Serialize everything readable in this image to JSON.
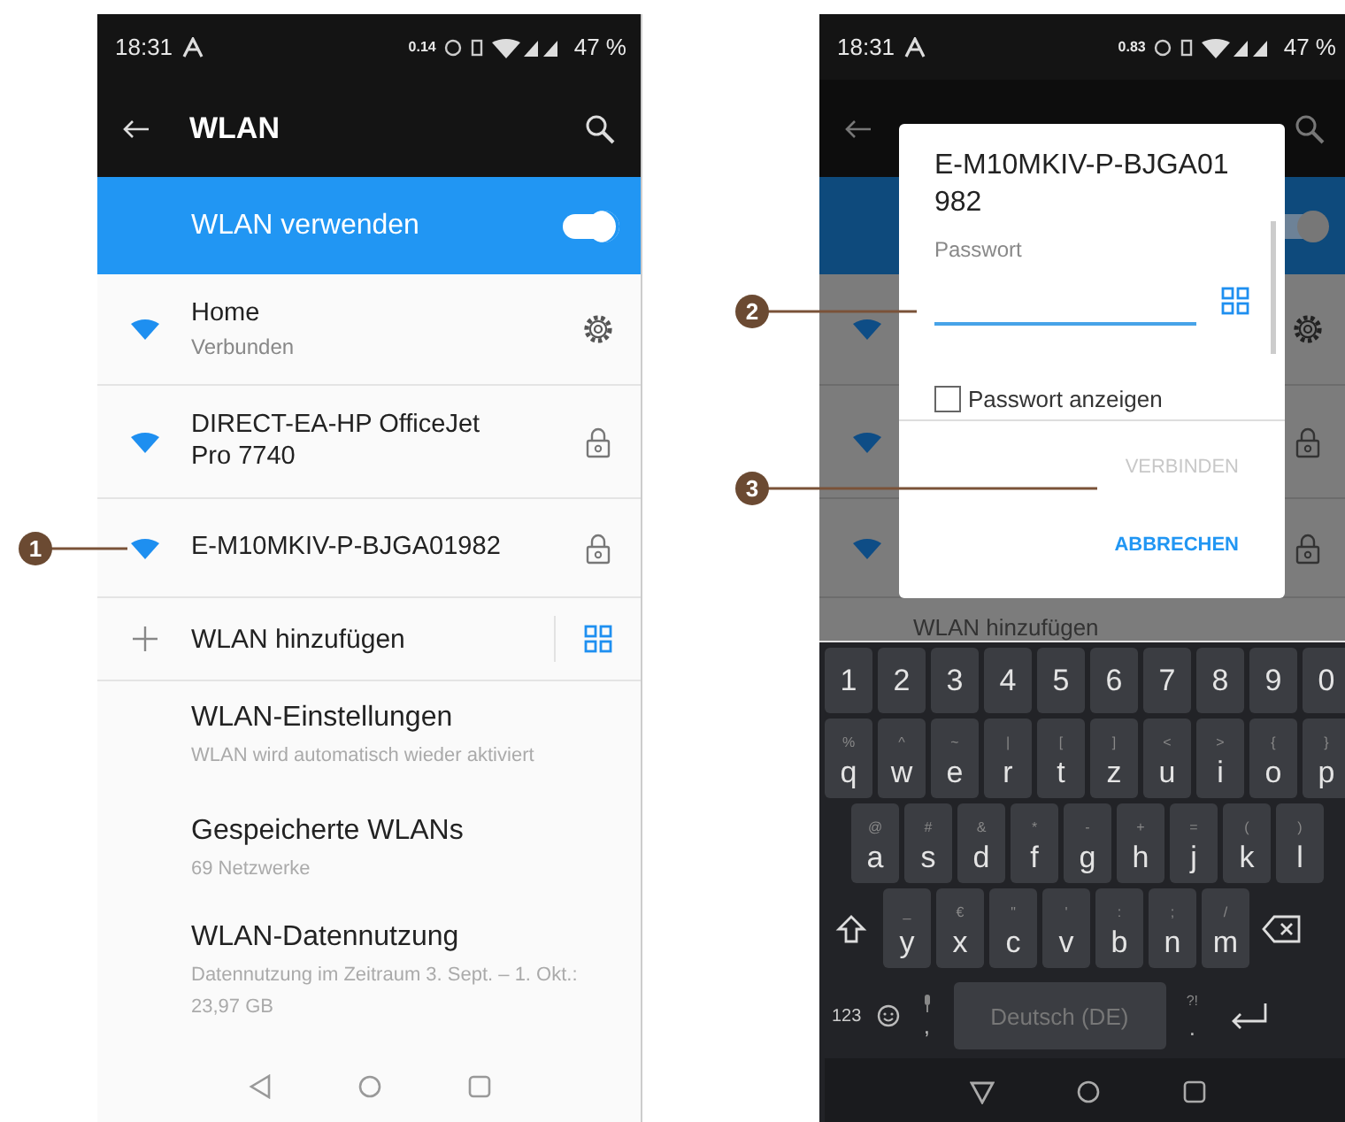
{
  "left_screen": {
    "status_bar": {
      "time": "18:31",
      "data_rate": "0.14",
      "battery": "47 %"
    },
    "toolbar": {
      "title": "WLAN"
    },
    "master_switch": {
      "label": "WLAN verwenden",
      "on": true
    },
    "networks": [
      {
        "name": "Home",
        "status": "Verbunden",
        "kind": "connected"
      },
      {
        "name": "DIRECT-EA-HP OfficeJet Pro 7740",
        "kind": "locked"
      },
      {
        "name": "E-M10MKIV-P-BJGA01982",
        "kind": "locked"
      }
    ],
    "add_network": {
      "label": "WLAN hinzufügen"
    },
    "settings_items": [
      {
        "title": "WLAN-Einstellungen",
        "subtitle": "WLAN wird automatisch wieder aktiviert"
      },
      {
        "title": "Gespeicherte WLANs",
        "subtitle": "69 Netzwerke"
      },
      {
        "title": "WLAN-Datennutzung",
        "subtitle": "Datennutzung im Zeitraum 3. Sept. – 1. Okt.: 23,97 GB"
      }
    ]
  },
  "right_screen": {
    "status_bar": {
      "time": "18:31",
      "data_rate": "0.83",
      "battery": "47 %"
    },
    "switch_on": true,
    "background_networks": [
      {
        "kind": "connected"
      },
      {
        "kind": "locked"
      },
      {
        "kind": "locked"
      }
    ],
    "add_network": {
      "label": "WLAN hinzufügen"
    },
    "dialog": {
      "title": "E-M10MKIV-P-BJGA01982",
      "field_label": "Passwort",
      "show_password": {
        "label": "Passwort anzeigen",
        "checked": false
      },
      "buttons": [
        {
          "label": "VERBINDEN",
          "disabled": true
        },
        {
          "label": "ABBRECHEN",
          "disabled": false
        }
      ]
    },
    "keyboard": {
      "rows": [
        {
          "keys": [
            {
              "key": "1"
            },
            {
              "key": "2"
            },
            {
              "key": "3"
            },
            {
              "key": "4"
            },
            {
              "key": "5"
            },
            {
              "key": "6"
            },
            {
              "key": "7"
            },
            {
              "key": "8"
            },
            {
              "key": "9"
            },
            {
              "key": "0"
            }
          ]
        },
        {
          "keys": [
            {
              "key": "q",
              "hint": "%"
            },
            {
              "key": "w",
              "hint": "^"
            },
            {
              "key": "e",
              "hint": "~"
            },
            {
              "key": "r",
              "hint": "|"
            },
            {
              "key": "t",
              "hint": "["
            },
            {
              "key": "z",
              "hint": "]"
            },
            {
              "key": "u",
              "hint": "<"
            },
            {
              "key": "i",
              "hint": ">"
            },
            {
              "key": "o",
              "hint": "{"
            },
            {
              "key": "p",
              "hint": "}"
            }
          ]
        },
        {
          "keys": [
            {
              "key": "a",
              "hint": "@"
            },
            {
              "key": "s",
              "hint": "#"
            },
            {
              "key": "d",
              "hint": "&"
            },
            {
              "key": "f",
              "hint": "*"
            },
            {
              "key": "g",
              "hint": "-"
            },
            {
              "key": "h",
              "hint": "+"
            },
            {
              "key": "j",
              "hint": "="
            },
            {
              "key": "k",
              "hint": "("
            },
            {
              "key": "l",
              "hint": ")"
            }
          ]
        },
        {
          "keys": [
            {
              "key": "y",
              "hint": "_"
            },
            {
              "key": "x",
              "hint": "€"
            },
            {
              "key": "c",
              "hint": "\""
            },
            {
              "key": "v",
              "hint": "'"
            },
            {
              "key": "b",
              "hint": ":"
            },
            {
              "key": "n",
              "hint": ";"
            },
            {
              "key": "m",
              "hint": "/"
            }
          ]
        }
      ],
      "mode_key": "123",
      "comma_key": ",",
      "space_label": "Deutsch (DE)",
      "period_key": ".",
      "period_hint": "?!"
    }
  },
  "callouts": [
    {
      "number": "1"
    },
    {
      "number": "2"
    },
    {
      "number": "3"
    }
  ]
}
